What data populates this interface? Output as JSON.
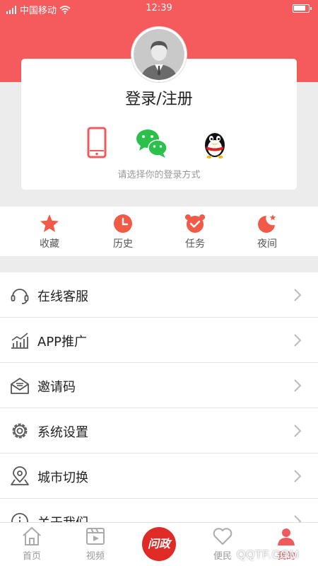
{
  "status_bar": {
    "carrier": "中国移动",
    "time": "12:39",
    "battery_level": 0.85
  },
  "login": {
    "title": "登录/注册",
    "hint": "请选择你的登录方式",
    "methods": [
      "phone-icon",
      "wechat-icon",
      "qq-icon"
    ]
  },
  "quick_actions": [
    {
      "label": "收藏",
      "icon": "star-icon"
    },
    {
      "label": "历史",
      "icon": "clock-icon"
    },
    {
      "label": "任务",
      "icon": "alarm-icon"
    },
    {
      "label": "夜间",
      "icon": "moon-icon"
    }
  ],
  "menu": [
    {
      "label": "在线客服",
      "icon": "headset-icon"
    },
    {
      "label": "APP推广",
      "icon": "chart-icon"
    },
    {
      "label": "邀请码",
      "icon": "envelope-icon"
    },
    {
      "label": "系统设置",
      "icon": "gear-icon"
    },
    {
      "label": "城市切换",
      "icon": "location-icon"
    },
    {
      "label": "关于我们",
      "icon": "info-icon"
    }
  ],
  "tabs": [
    {
      "label": "首页",
      "icon": "home-icon"
    },
    {
      "label": "视频",
      "icon": "video-icon"
    },
    {
      "label": "问政",
      "icon": "wenzheng-logo"
    },
    {
      "label": "便民",
      "icon": "heart-icon"
    },
    {
      "label": "我的",
      "icon": "user-icon"
    }
  ],
  "watermark": "QQTF.COM",
  "colors": {
    "accent": "#f55a5c",
    "tab_center": "#e02a26",
    "wechat": "#29c14a"
  }
}
